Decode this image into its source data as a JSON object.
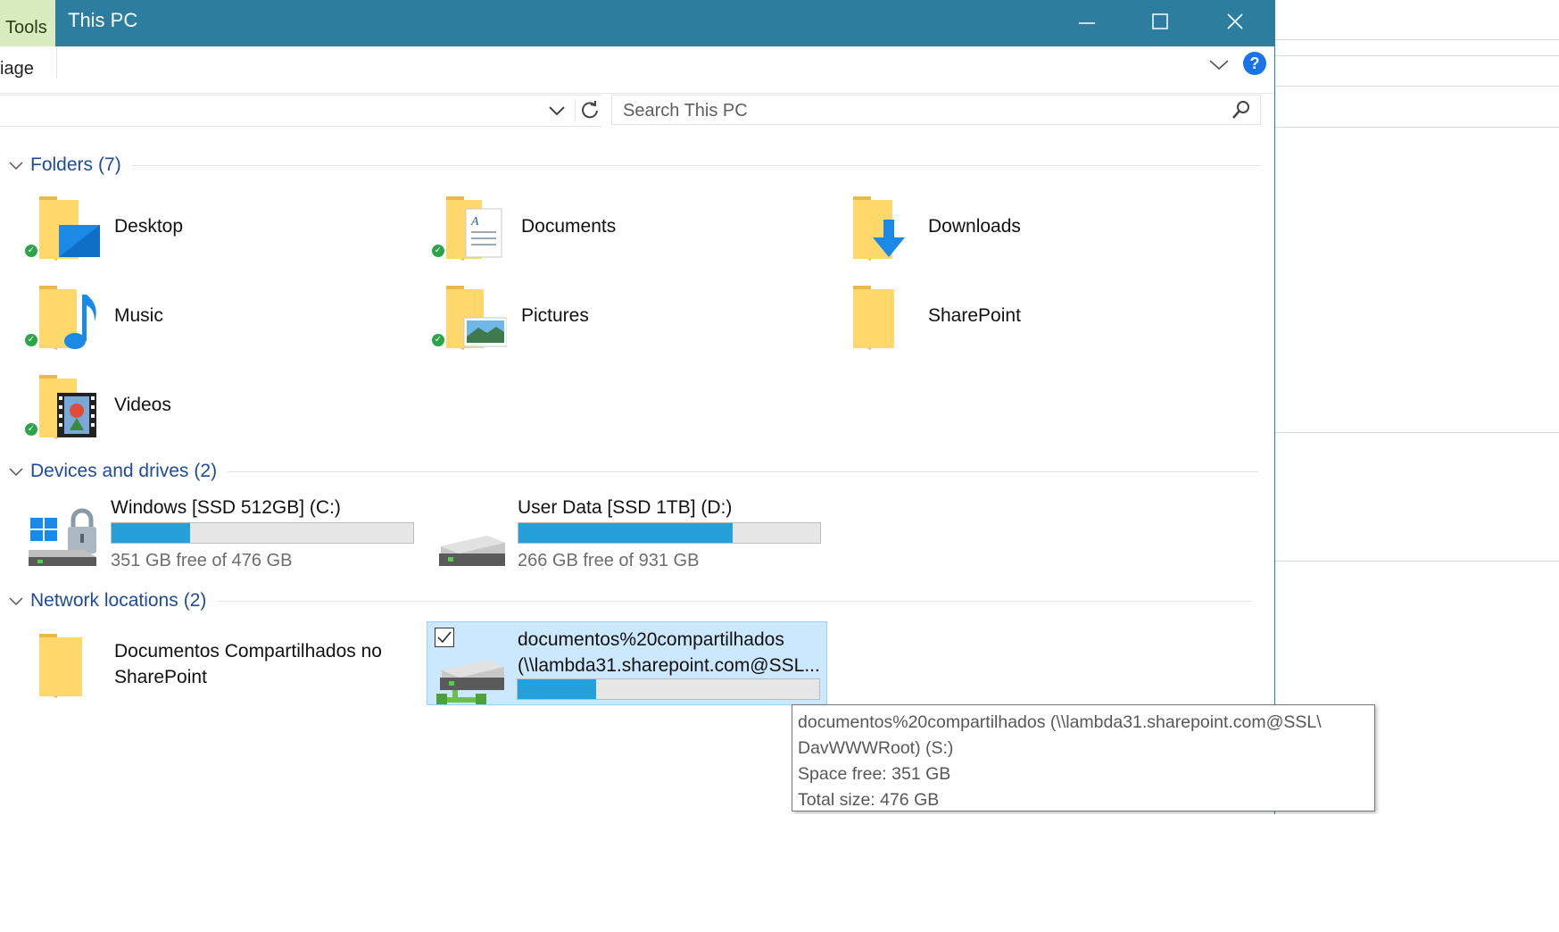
{
  "titlebar": {
    "context_tab": "Tools",
    "title": "This PC"
  },
  "ribbon": {
    "tab_label": "iage"
  },
  "addressbar": {
    "partial_text": ""
  },
  "search": {
    "placeholder": "Search This PC"
  },
  "groups": {
    "folders": {
      "label": "Folders",
      "count": "(7)"
    },
    "devices": {
      "label": "Devices and drives",
      "count": "(2)"
    },
    "network": {
      "label": "Network locations",
      "count": "(2)"
    }
  },
  "folders": [
    {
      "name": "Desktop"
    },
    {
      "name": "Documents"
    },
    {
      "name": "Downloads"
    },
    {
      "name": "Music"
    },
    {
      "name": "Pictures"
    },
    {
      "name": "SharePoint"
    },
    {
      "name": "Videos"
    }
  ],
  "drives": [
    {
      "name": "Windows [SSD 512GB] (C:)",
      "free_text": "351 GB free of 476 GB",
      "used_fraction": 0.26
    },
    {
      "name": "User Data [SSD 1TB] (D:)",
      "free_text": "266 GB free of 931 GB",
      "used_fraction": 0.71
    }
  ],
  "network": [
    {
      "name_line1": "Documentos Compartilhados no",
      "name_line2": "SharePoint"
    },
    {
      "name_line1": "documentos%20compartilhados",
      "name_line2": "(\\\\lambda31.sharepoint.com@SSL...",
      "used_fraction": 0.26
    }
  ],
  "tooltip": {
    "line1": "documentos%20compartilhados (\\\\lambda31.sharepoint.com@SSL\\",
    "line2": "DavWWWRoot) (S:)",
    "line3": "Space free: 351 GB",
    "line4": "Total size: 476 GB"
  },
  "colors": {
    "titlebar": "#2d7e9e",
    "group_header": "#1e4a9a",
    "selection": "#cce8ff",
    "bar_fill": "#26a0da",
    "sync_ok": "#2ca54a"
  }
}
